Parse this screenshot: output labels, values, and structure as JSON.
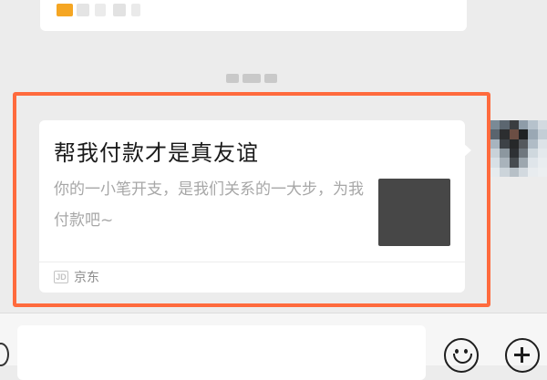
{
  "card": {
    "title": "帮我付款才是真友谊",
    "description": "你的一小笔开支，是我们关系的一大步，为我付款吧~",
    "source_name": "京东",
    "source_icon": "jd-icon",
    "thumbnail_color": "#474747"
  },
  "composer": {
    "emoji_icon": "emoji-icon",
    "more_icon": "plus-icon"
  },
  "colors": {
    "highlight_border": "#ff6a3d",
    "chat_background": "#ececec",
    "bubble_background": "#ffffff"
  }
}
